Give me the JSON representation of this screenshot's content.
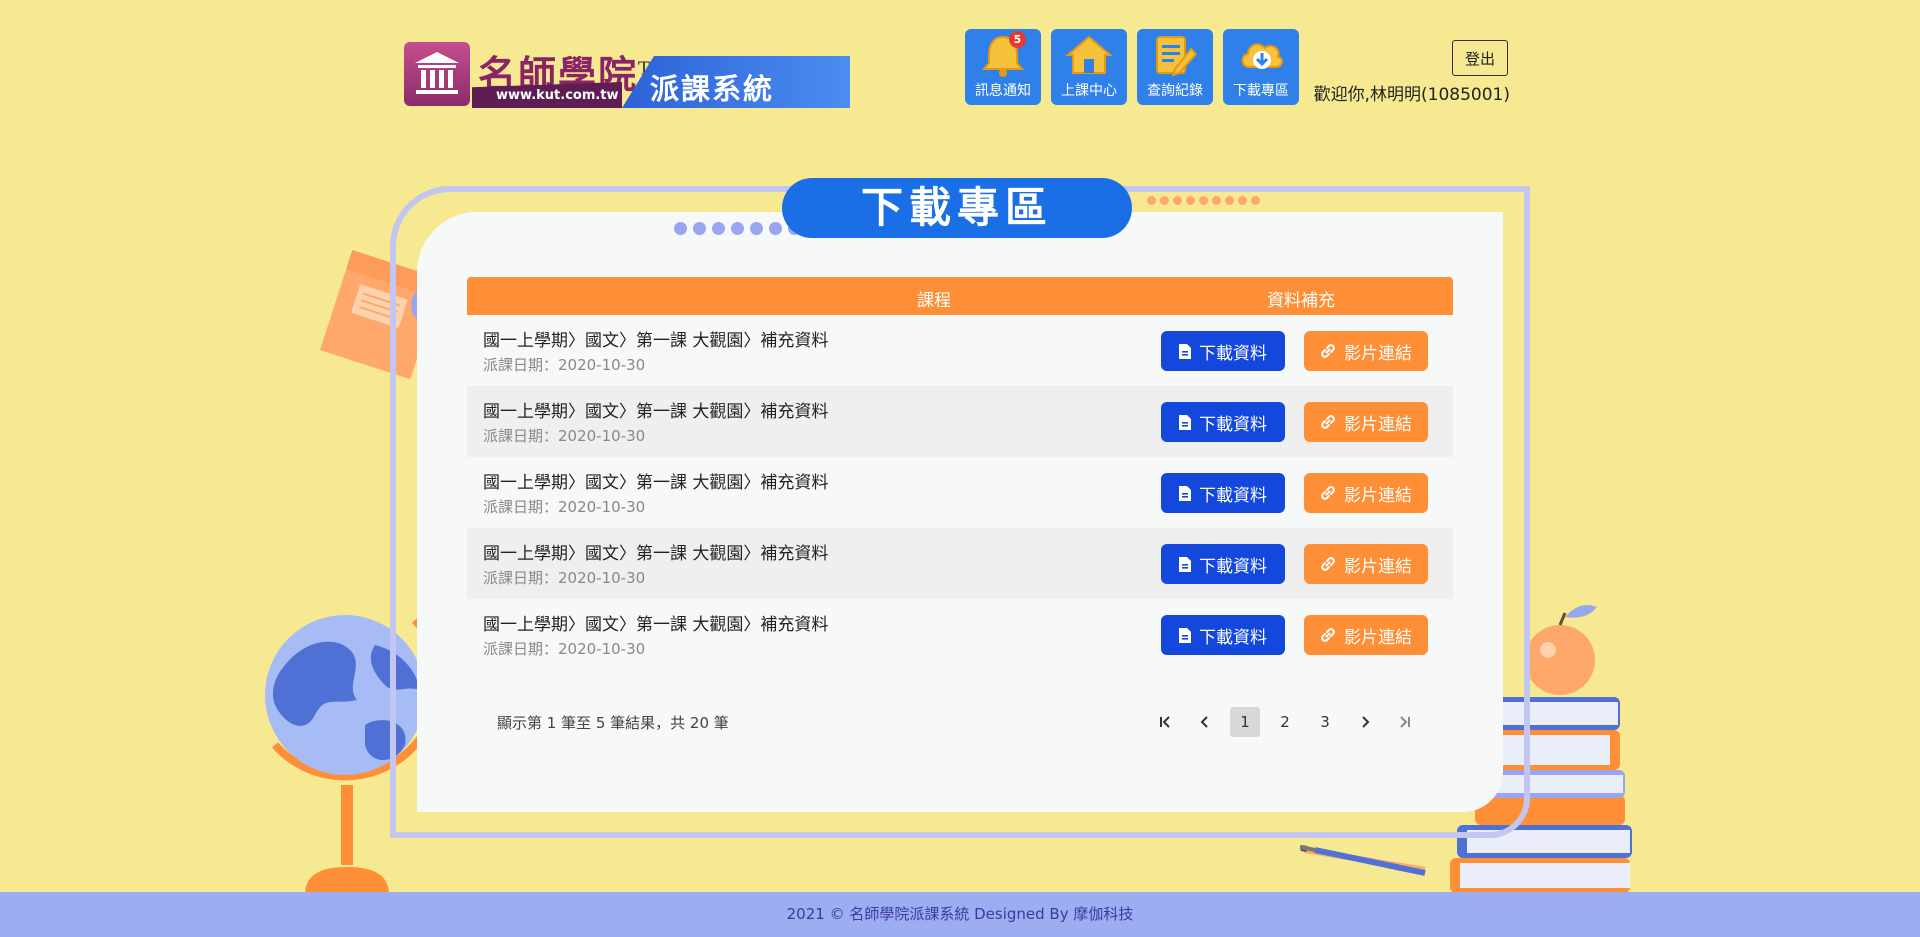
{
  "header": {
    "logo_title": "名師學院",
    "logo_tm": "TM",
    "logo_url": "www.kut.com.tw",
    "logo_subtitle": "派課系統",
    "nav": [
      {
        "label": "訊息通知",
        "badge": "5",
        "icon": "bell-icon"
      },
      {
        "label": "上課中心",
        "icon": "house-icon"
      },
      {
        "label": "查詢紀錄",
        "icon": "clipboard-pencil-icon"
      },
      {
        "label": "下載專區",
        "icon": "cloud-download-icon"
      }
    ],
    "logout_label": "登出",
    "welcome_text": "歡迎你,林明明(1085001)"
  },
  "main": {
    "title": "下載專區",
    "table": {
      "headers": {
        "course": "課程",
        "extra": "資料補充"
      },
      "rows": [
        {
          "title": "國一上學期〉國文〉第一課 大觀園〉補充資料",
          "date": "派課日期：2020-10-30",
          "download_label": "下載資料",
          "video_label": "影片連結"
        },
        {
          "title": "國一上學期〉國文〉第一課 大觀園〉補充資料",
          "date": "派課日期：2020-10-30",
          "download_label": "下載資料",
          "video_label": "影片連結"
        },
        {
          "title": "國一上學期〉國文〉第一課 大觀園〉補充資料",
          "date": "派課日期：2020-10-30",
          "download_label": "下載資料",
          "video_label": "影片連結"
        },
        {
          "title": "國一上學期〉國文〉第一課 大觀園〉補充資料",
          "date": "派課日期：2020-10-30",
          "download_label": "下載資料",
          "video_label": "影片連結"
        },
        {
          "title": "國一上學期〉國文〉第一課 大觀園〉補充資料",
          "date": "派課日期：2020-10-30",
          "download_label": "下載資料",
          "video_label": "影片連結"
        }
      ]
    },
    "summary": "顯示第 1 筆至 5 筆結果，共 20 筆",
    "pagination": {
      "pages": [
        "1",
        "2",
        "3"
      ],
      "current": "1"
    }
  },
  "footer": {
    "text": "2021 © 名師學院派課系統 Designed By 摩伽科技"
  },
  "colors": {
    "background": "#f6e991",
    "title_pill": "#1b6fe6",
    "table_header": "#fe8f36",
    "download_button": "#1447db",
    "video_button": "#fe8f36",
    "footer": "#9cadf1",
    "nav_tile": "#2f80e8"
  }
}
